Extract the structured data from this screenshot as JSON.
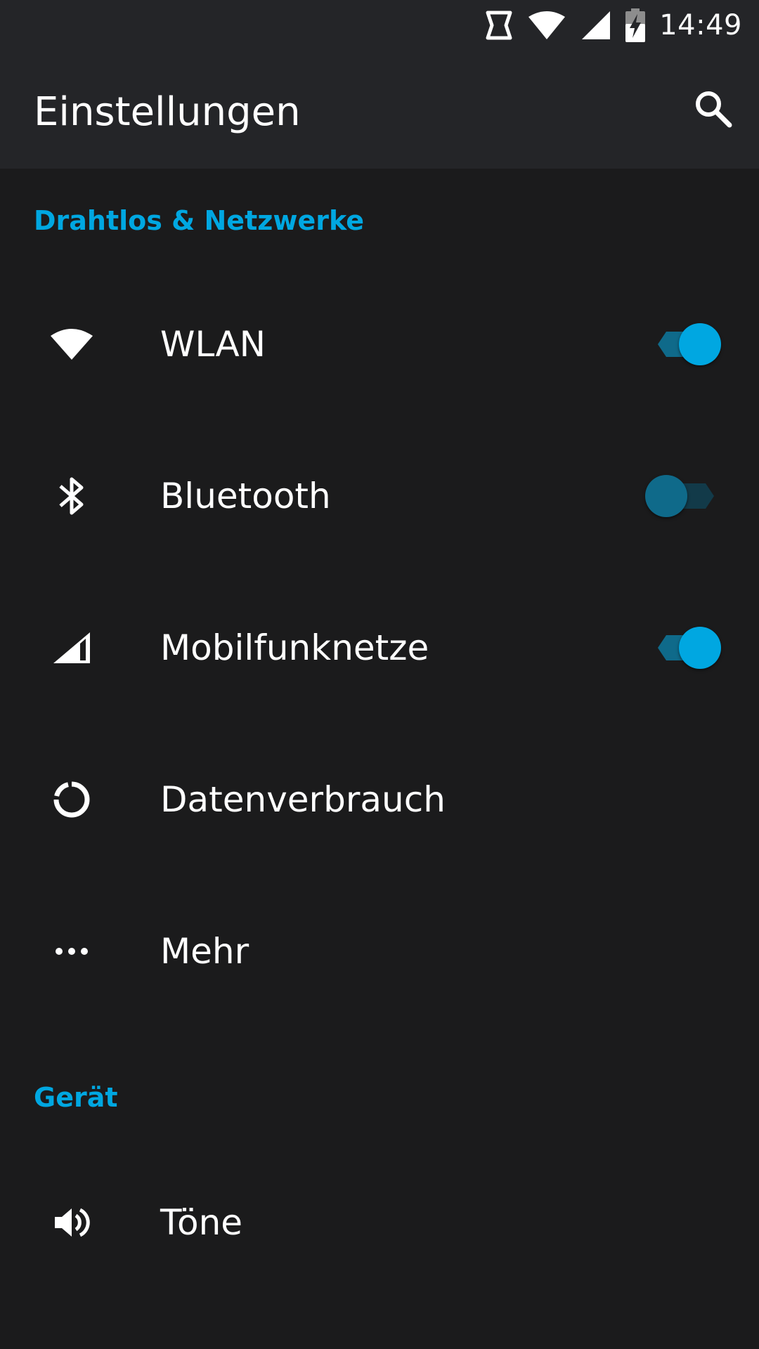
{
  "status_bar": {
    "time": "14:49",
    "icons": [
      "nfc-icon",
      "wifi-icon",
      "cell-signal-icon",
      "battery-charging-icon"
    ]
  },
  "app_bar": {
    "title": "Einstellungen",
    "search_icon": "search-icon"
  },
  "sections": {
    "wireless": {
      "header": "Drahtlos & Netzwerke",
      "items": [
        {
          "label": "WLAN",
          "icon": "wifi-icon",
          "toggle": "on"
        },
        {
          "label": "Bluetooth",
          "icon": "bluetooth-icon",
          "toggle": "off"
        },
        {
          "label": "Mobilfunknetze",
          "icon": "cell-signal-icon",
          "toggle": "on"
        },
        {
          "label": "Datenverbrauch",
          "icon": "data-usage-icon"
        },
        {
          "label": "Mehr",
          "icon": "more-dots-icon"
        }
      ]
    },
    "device": {
      "header": "Gerät",
      "items": [
        {
          "label": "Töne",
          "icon": "volume-icon"
        }
      ]
    }
  },
  "colors": {
    "accent": "#00a7e1",
    "background": "#1b1b1c",
    "bar": "#242528",
    "switch_track_on": "#0f6a8a",
    "switch_track_off": "#123a49"
  }
}
